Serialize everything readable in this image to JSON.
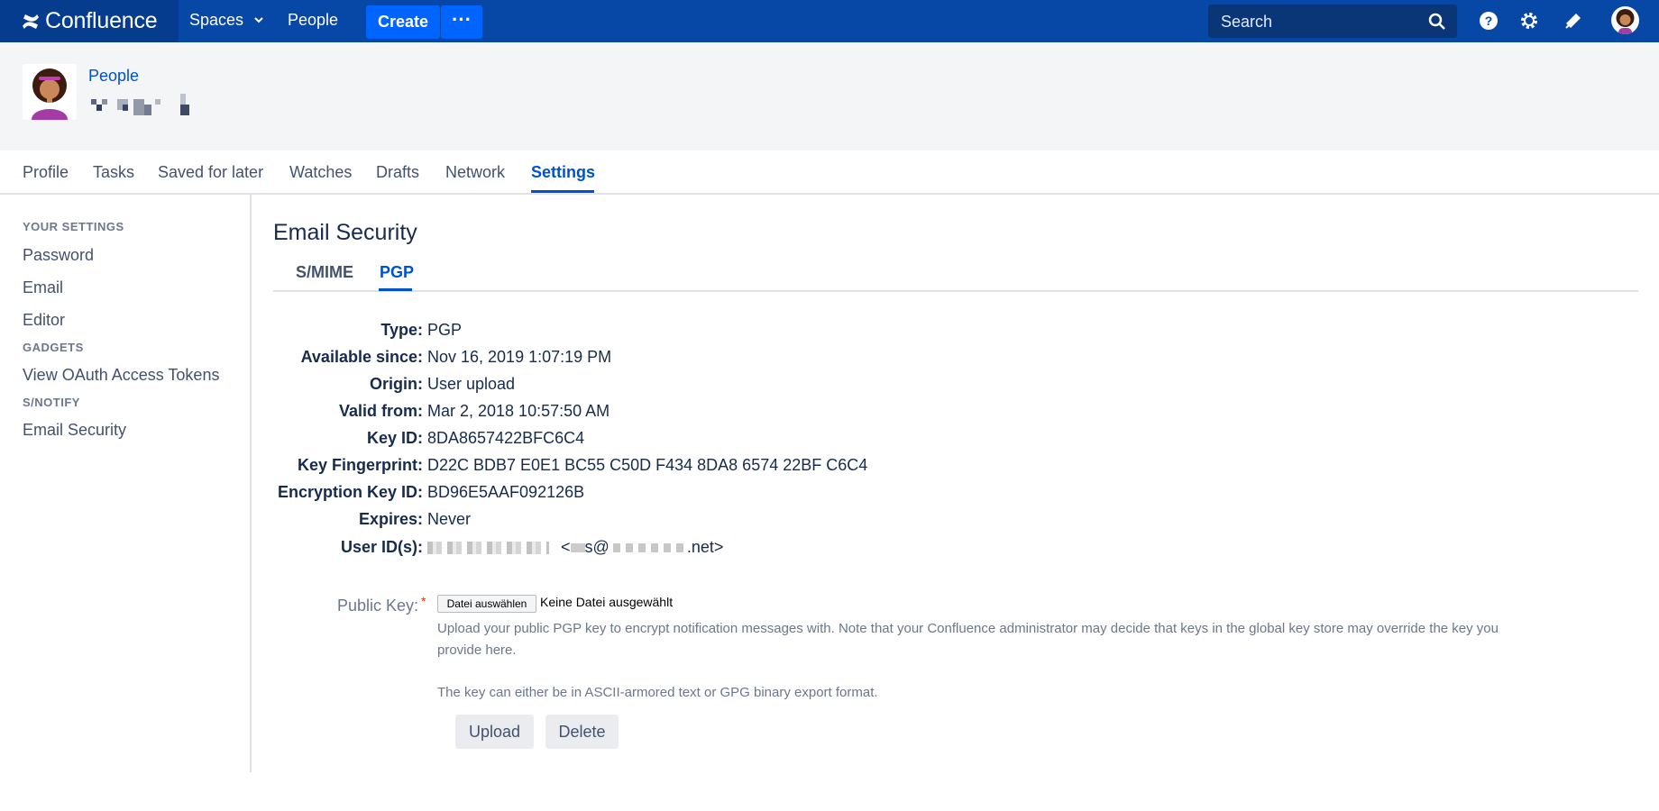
{
  "topnav": {
    "product": "Confluence",
    "spaces": "Spaces",
    "people": "People",
    "create": "Create",
    "more": "···",
    "search_placeholder": "Search",
    "icons": [
      "confluence-logo-icon",
      "chevron-down-icon",
      "search-icon",
      "help-icon",
      "gear-icon",
      "megaphone-icon",
      "avatar"
    ]
  },
  "header": {
    "breadcrumb": "People"
  },
  "tabs": [
    "Profile",
    "Tasks",
    "Saved for later",
    "Watches",
    "Drafts",
    "Network",
    "Settings"
  ],
  "active_tab": "Settings",
  "sidebar": {
    "your_settings": "YOUR SETTINGS",
    "password": "Password",
    "email": "Email",
    "editor": "Editor",
    "gadgets": "GADGETS",
    "oauth": "View OAuth Access Tokens",
    "snotify": "S/NOTIFY",
    "email_security": "Email Security"
  },
  "main": {
    "title": "Email Security",
    "subtabs": {
      "smime": "S/MIME",
      "pgp": "PGP"
    },
    "active_subtab": "PGP",
    "fields": {
      "type": {
        "label": "Type:",
        "value": "PGP"
      },
      "available": {
        "label": "Available since:",
        "value": "Nov 16, 2019 1:07:19 PM"
      },
      "origin": {
        "label": "Origin:",
        "value": "User upload"
      },
      "valid_from": {
        "label": "Valid from:",
        "value": "Mar 2, 2018 10:57:50 AM"
      },
      "key_id": {
        "label": "Key ID:",
        "value": "8DA8657422BFC6C4"
      },
      "fingerprint": {
        "label": "Key Fingerprint:",
        "value": "D22C BDB7 E0E1 BC55 C50D F434 8DA8 6574 22BF C6C4"
      },
      "enc_key_id": {
        "label": "Encryption Key ID:",
        "value": "BD96E5AAF092126B"
      },
      "expires": {
        "label": "Expires:",
        "value": "Never"
      },
      "user_ids": {
        "label": "User ID(s):",
        "value_start": "<",
        "value_mid": "s@",
        "value_end": ".net>"
      }
    },
    "public_key": {
      "label": "Public Key:",
      "required_marker": "*",
      "file_button": "Datei auswählen",
      "file_status": "Keine Datei ausgewählt",
      "help_1a": "Upload your public PGP key to encrypt notification messages with. Note that your Confluence administrator may decide that keys in the global key store may override the key you",
      "help_1b": "provide here.",
      "help_2": "The key can either be in ASCII-armored text or GPG binary export format."
    },
    "buttons": {
      "upload": "Upload",
      "delete": "Delete"
    }
  }
}
